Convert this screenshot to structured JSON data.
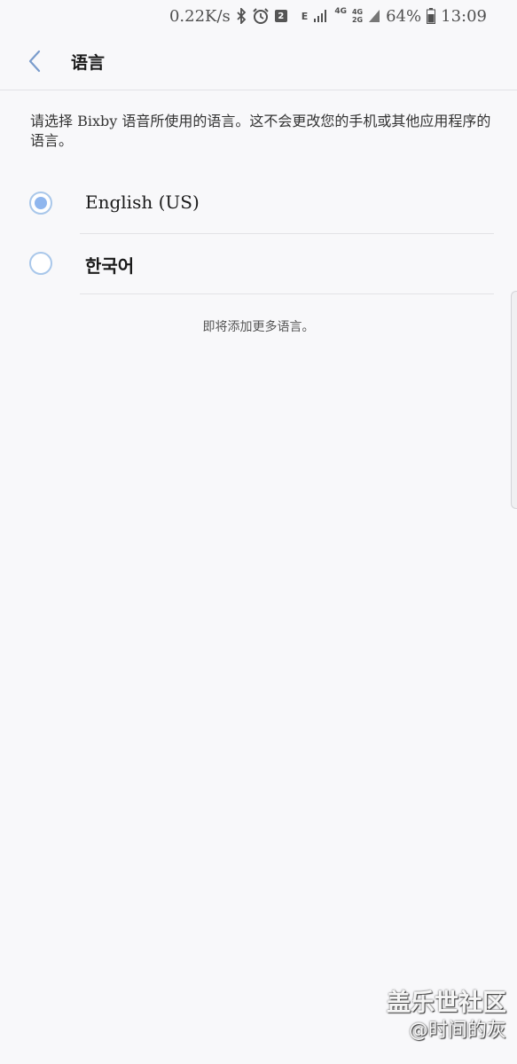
{
  "status_bar": {
    "net_speed": "0.22K/s",
    "notification_count": "2",
    "network_e": "E",
    "network_4g": "4G",
    "network_4g2g_top": "4G",
    "network_4g2g_bottom": "2G",
    "battery": "64%",
    "time": "13:09",
    "icons": [
      "bluetooth-icon",
      "alarm-icon",
      "signal-icon",
      "battery-icon"
    ]
  },
  "header": {
    "title": "语言",
    "back_icon": "chevron-left-icon"
  },
  "description": "请选择 Bixby 语音所使用的语言。这不会更改您的手机或其他应用程序的语言。",
  "options": [
    {
      "label": "English (US)",
      "selected": true
    },
    {
      "label": "한국어",
      "selected": false
    }
  ],
  "more_note": "即将添加更多语言。",
  "watermark": {
    "line1": "盖乐世社区",
    "line2": "@时间的灰"
  },
  "colors": {
    "background": "#f8f8fa",
    "accent": "#8fb6ee",
    "radio_border": "#a9c7ea",
    "divider": "#e2e2e6"
  }
}
